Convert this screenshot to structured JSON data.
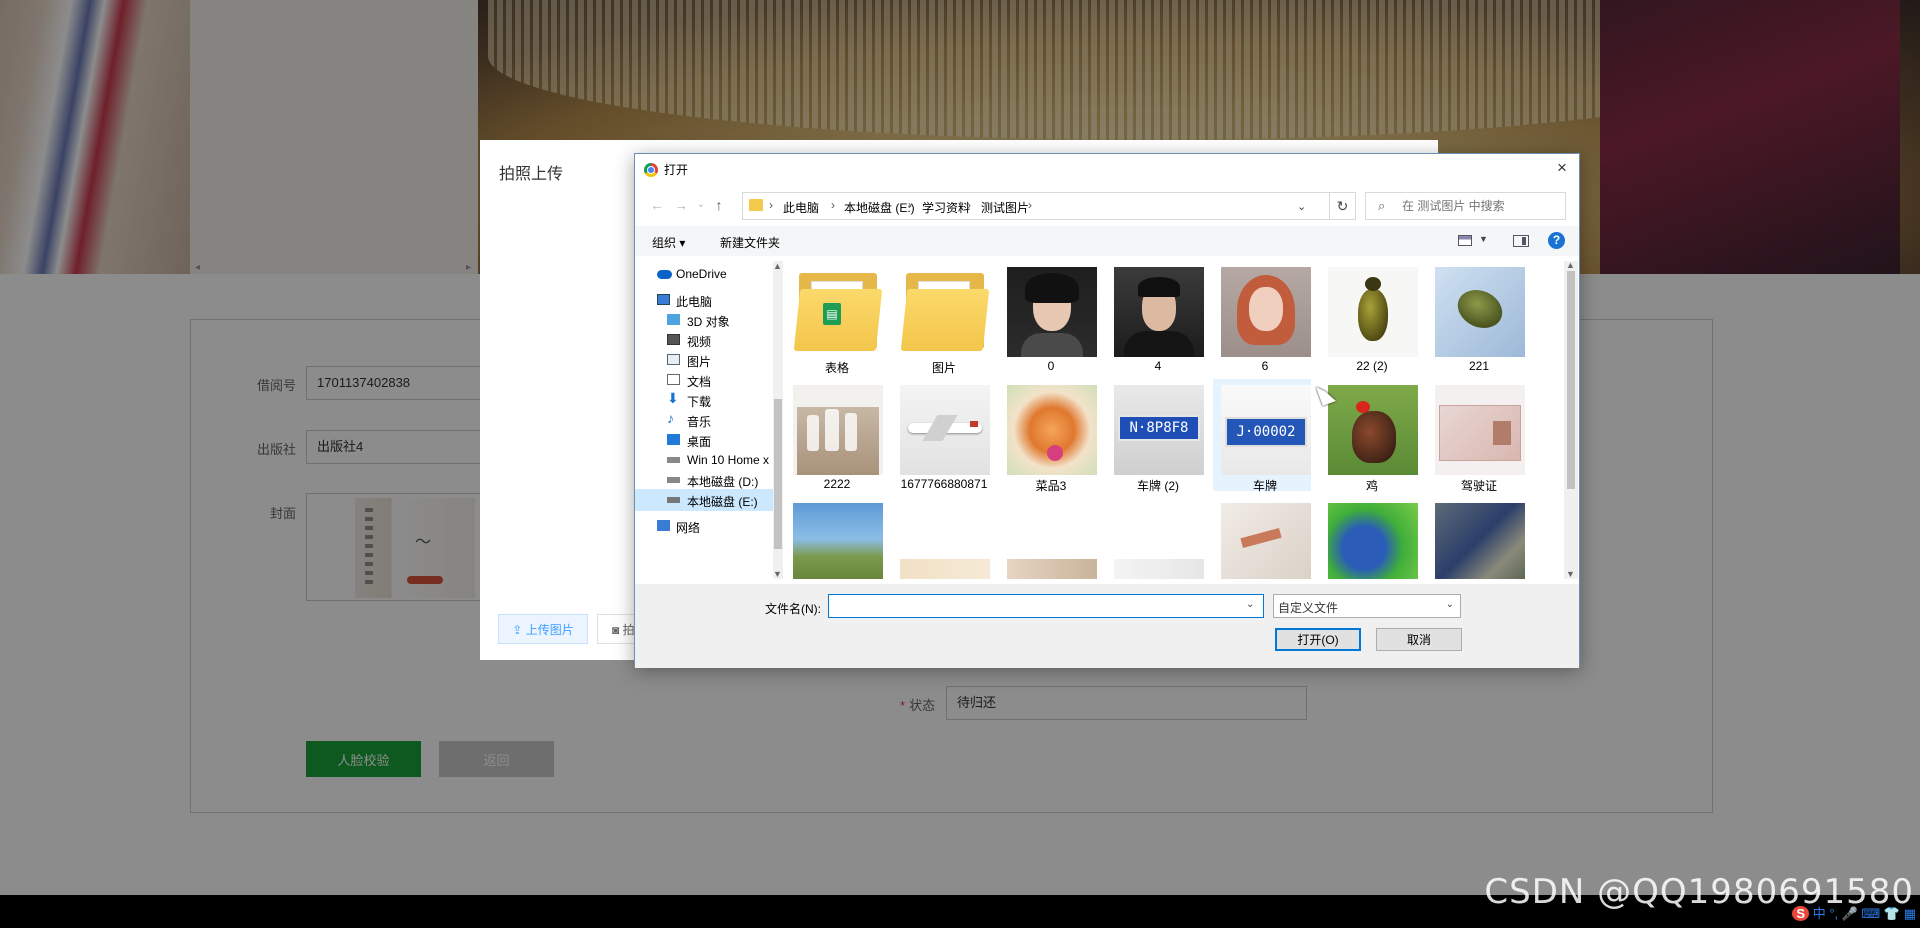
{
  "background_form": {
    "fields": [
      {
        "label": "借阅号",
        "value": "1701137402838"
      },
      {
        "label": "出版社",
        "value": "出版社4"
      },
      {
        "label": "封面",
        "value": ""
      }
    ],
    "status_label": "状态",
    "status_value": "待归还",
    "face_button": "人脸校验",
    "back_button": "返回"
  },
  "upload_modal": {
    "title": "拍照上传",
    "upload_button": "上传图片",
    "camera_button": "拍"
  },
  "dialog": {
    "title": "打开",
    "close_glyph": "×",
    "breadcrumb": [
      "此电脑",
      "本地磁盘 (E:)",
      "学习资料",
      "测试图片"
    ],
    "search_placeholder": "在 测试图片 中搜索",
    "toolbar": {
      "organize": "组织 ▾",
      "new_folder": "新建文件夹",
      "help": "?"
    },
    "nav_items": [
      {
        "label": "OneDrive",
        "icon": "cloud-icon"
      },
      {
        "label": "此电脑",
        "icon": "computer-icon"
      },
      {
        "label": "3D 对象",
        "icon": "cube-icon"
      },
      {
        "label": "视频",
        "icon": "video-icon"
      },
      {
        "label": "图片",
        "icon": "pictures-icon"
      },
      {
        "label": "文档",
        "icon": "document-icon"
      },
      {
        "label": "下载",
        "icon": "download-icon"
      },
      {
        "label": "音乐",
        "icon": "music-icon"
      },
      {
        "label": "桌面",
        "icon": "desktop-icon"
      },
      {
        "label": "Win 10 Home x",
        "icon": "drive-icon"
      },
      {
        "label": "本地磁盘 (D:)",
        "icon": "drive-icon"
      },
      {
        "label": "本地磁盘 (E:)",
        "icon": "drive-icon",
        "selected": true
      },
      {
        "label": "网络",
        "icon": "network-icon"
      }
    ],
    "files": [
      {
        "name": "表格",
        "kind": "folder"
      },
      {
        "name": "图片",
        "kind": "folder"
      },
      {
        "name": "0",
        "kind": "portrait"
      },
      {
        "name": "4",
        "kind": "portrait"
      },
      {
        "name": "6",
        "kind": "portrait"
      },
      {
        "name": "22 (2)",
        "kind": "beetle"
      },
      {
        "name": "221",
        "kind": "beetle"
      },
      {
        "name": "2222",
        "kind": "bottles"
      },
      {
        "name": "1677766880871",
        "kind": "airplane"
      },
      {
        "name": "菜品3",
        "kind": "food"
      },
      {
        "name": "车牌 (2)",
        "kind": "plate"
      },
      {
        "name": "车牌",
        "kind": "plate"
      },
      {
        "name": "鸡",
        "kind": "rooster"
      },
      {
        "name": "驾驶证",
        "kind": "license"
      }
    ],
    "filename_label": "文件名(N):",
    "filename_value": "",
    "filetype_value": "自定义文件",
    "open_button": "打开(O)",
    "cancel_button": "取消"
  },
  "watermark": "CSDN @QQ1980691580",
  "ime_text": "中 °, 🎤 ⌨ 👕 ▦",
  "colors": {
    "accent": "#0078d7",
    "green_button": "#1aa33a",
    "selection": "#cce8ff"
  }
}
